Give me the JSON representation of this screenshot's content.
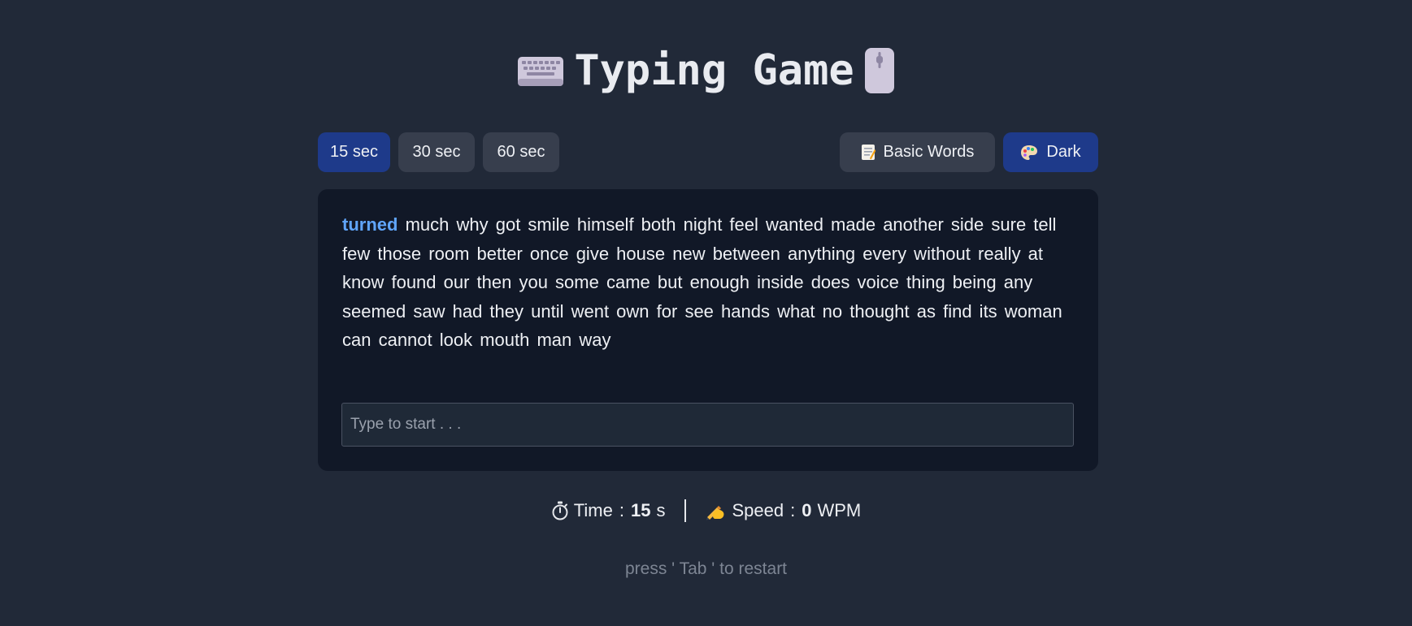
{
  "header": {
    "title": "Typing Game",
    "left_icon": "keyboard-icon",
    "right_icon": "mouse-icon"
  },
  "time_options": [
    {
      "label": "15 sec",
      "active": true
    },
    {
      "label": "30 sec",
      "active": false
    },
    {
      "label": "60 sec",
      "active": false
    }
  ],
  "word_set": {
    "label": "Basic Words",
    "icon": "memo-icon"
  },
  "theme": {
    "label": "Dark",
    "icon": "palette-icon"
  },
  "text": {
    "current_word": "turned",
    "remaining_words": "much why got smile himself both night feel wanted made another side sure tell few those room better once give house new between anything every without really at know found our then you some came but enough inside does voice thing being any seemed saw had they until went own for see hands what no thought as find its woman can cannot look mouth man way"
  },
  "input": {
    "value": "",
    "placeholder": "Type to start . . ."
  },
  "stats": {
    "time_icon": "stopwatch-icon",
    "time_label": "Time",
    "colon": ":",
    "time_value": "15",
    "time_unit": "s",
    "speed_icon": "writing-hand-icon",
    "speed_label": "Speed",
    "speed_value": "0",
    "speed_unit": "WPM"
  },
  "hint": "press ' Tab ' to restart",
  "colors": {
    "background": "#212938",
    "card": "#111827",
    "accent": "#1e3a8a",
    "current_word": "#60a5fa"
  }
}
